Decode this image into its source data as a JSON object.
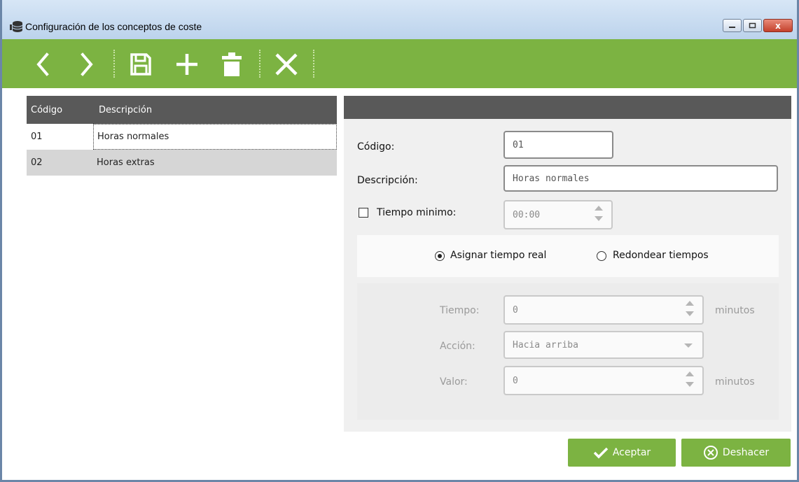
{
  "window": {
    "title": "Configuración de los conceptos de coste",
    "close_glyph": "x"
  },
  "toolbar": {
    "icons": [
      "chevron-left-icon",
      "chevron-right-icon",
      "save-icon",
      "plus-icon",
      "trash-icon",
      "close-icon"
    ],
    "background": "#7cb342"
  },
  "grid": {
    "columns": [
      "Código",
      "Descripción"
    ],
    "rows": [
      {
        "codigo": "01",
        "descripcion": "Horas normales"
      },
      {
        "codigo": "02",
        "descripcion": "Horas extras"
      }
    ]
  },
  "form": {
    "codigo_label": "Código:",
    "codigo_value": "01",
    "descripcion_label": "Descripción:",
    "descripcion_value": "Horas normales",
    "tiempo_minimo_label": "Tiempo minimo:",
    "tiempo_minimo_checked": false,
    "tiempo_minimo_value": "00:00",
    "radio_real_label": "Asignar tiempo real",
    "radio_redondear_label": "Redondear tiempos",
    "radio_selected": "real",
    "tiempo_label": "Tiempo:",
    "tiempo_value": "0",
    "tiempo_unit": "minutos",
    "accion_label": "Acción:",
    "accion_value": "Hacia arriba",
    "valor_label": "Valor:",
    "valor_value": "0",
    "valor_unit": "minutos"
  },
  "buttons": {
    "aceptar": "Aceptar",
    "deshacer": "Deshacer"
  }
}
